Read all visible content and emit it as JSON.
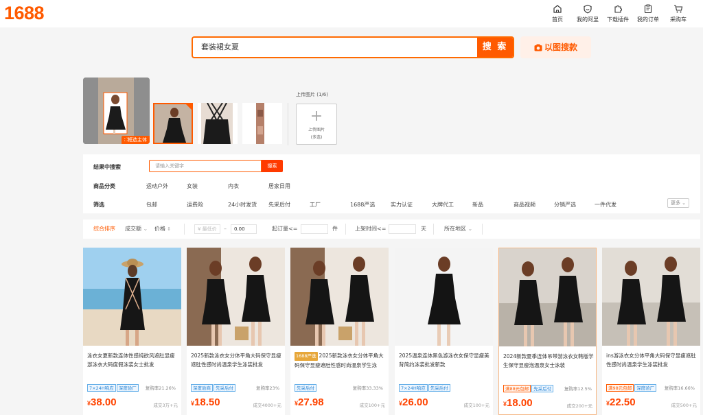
{
  "header": {
    "logo": "1688",
    "nav": [
      {
        "label": "首页",
        "icon": "home-icon"
      },
      {
        "label": "我的阿里",
        "icon": "user-shield-icon"
      },
      {
        "label": "下载插件",
        "icon": "puzzle-icon"
      },
      {
        "label": "我的订单",
        "icon": "order-list-icon"
      },
      {
        "label": "采购车",
        "icon": "cart-icon"
      }
    ]
  },
  "search": {
    "value": "套装裙女夏",
    "button": "搜 索",
    "image_search": "以图搜款"
  },
  "image_panel": {
    "select_subject": "框选主体",
    "upload_label": "上传图片 (1/6)",
    "upload_box_line1": "上传图片",
    "upload_box_line2": "(多选)"
  },
  "filters": {
    "keyword_label": "结果中搜索",
    "keyword_placeholder": "请输入关键字",
    "keyword_button": "搜索",
    "category_label": "商品分类",
    "categories": [
      "运动户外",
      "女装",
      "内衣",
      "居家日用"
    ],
    "screen_label": "筛选",
    "screens": [
      "包邮",
      "运费险",
      "24小时发货",
      "先采后付",
      "工厂",
      "1688严选",
      "实力认证",
      "大牌代工",
      "新品",
      "商品视频",
      "分销严选",
      "一件代发"
    ],
    "more": "更多"
  },
  "sort": {
    "overall": "综合排序",
    "volume": "成交额",
    "price": "价格",
    "min_price_placeholder": "¥ 最低价",
    "dash": "–",
    "max_price_value": "0.00",
    "moq_label": "起订量<=",
    "moq_unit": "件",
    "listed_label": "上架时间<=",
    "listed_unit": "天",
    "region": "所在地区"
  },
  "products": [
    {
      "title": "泳衣女夏新款连体性感纯欲风遮肚显瘦游泳衣大码度假泳装女士批发",
      "badge": "",
      "tags": [
        {
          "t": "7×24H响应",
          "c": "blue"
        },
        {
          "t": "深度验厂",
          "c": "blue"
        }
      ],
      "repurchase": "复购率21.26%",
      "price": "38.00",
      "sold": "成交3万+元",
      "hl": false
    },
    {
      "title": "2025新款泳衣女分体平角大码保守显瘦遮肚性感时尚温泉学生泳装批发",
      "badge": "",
      "tags": [
        {
          "t": "深度验商",
          "c": "blue"
        },
        {
          "t": "先采后付",
          "c": "blue"
        }
      ],
      "repurchase": "复购率23%",
      "price": "18.50",
      "sold": "成交4000+元",
      "hl": false
    },
    {
      "title": "2025新款泳衣女分体平角大码保守显瘦遮肚性感时尚温泉学生泳",
      "badge": "1688严选",
      "tags": [
        {
          "t": "先采后付",
          "c": "blue"
        }
      ],
      "repurchase": "复购率33.33%",
      "price": "27.98",
      "sold": "成交100+元",
      "hl": false
    },
    {
      "title": "2025温泉连体黑色游泳衣女保守显瘦美背简约泳装批发新款",
      "badge": "",
      "tags": [
        {
          "t": "7×24H响应",
          "c": "blue"
        },
        {
          "t": "先采后付",
          "c": "blue"
        }
      ],
      "repurchase": "",
      "price": "26.00",
      "sold": "成交100+元",
      "hl": false
    },
    {
      "title": "2024新款夏季连体吊带游泳衣女韩版学生保守显瘦泡温泉女士泳装",
      "badge": "",
      "tags": [
        {
          "t": "满88元包邮",
          "c": "red"
        },
        {
          "t": "先采后付",
          "c": "blue"
        }
      ],
      "repurchase": "复购率12.5%",
      "price": "18.00",
      "sold": "成交200+元",
      "hl": true
    },
    {
      "title": "ins游泳衣女分体平角大码保守显瘦遮肚性感时尚温泉学生泳装批发",
      "badge": "",
      "tags": [
        {
          "t": "满98元包邮",
          "c": "red"
        },
        {
          "t": "深度验厂",
          "c": "blue"
        }
      ],
      "repurchase": "复购率16.66%",
      "price": "22.50",
      "sold": "成交500+元",
      "hl": false
    }
  ],
  "currency_symbol": "¥",
  "colors": {
    "accent": "#ff5a00",
    "price": "#ff4400",
    "tag_blue": "#2a86d6"
  }
}
